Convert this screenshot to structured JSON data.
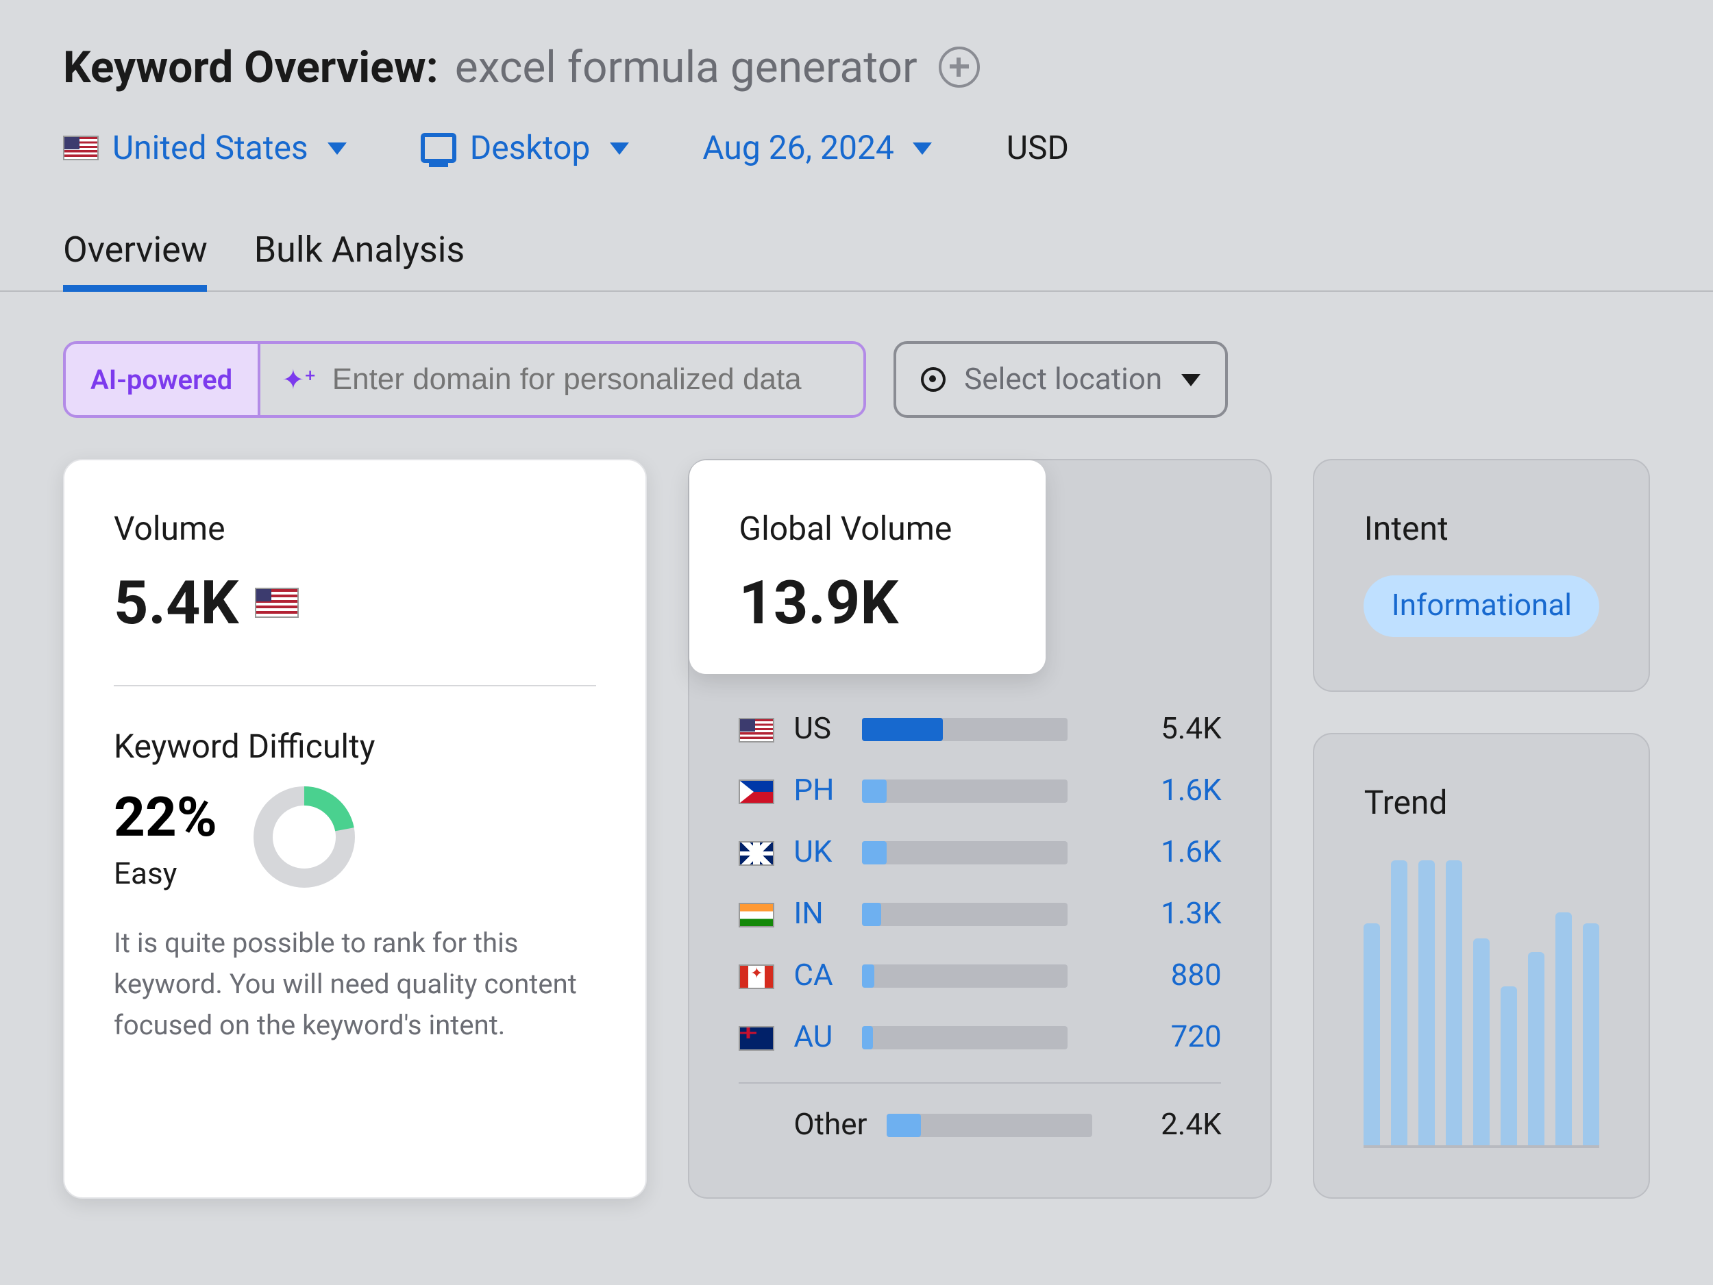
{
  "header": {
    "title_label": "Keyword Overview:",
    "keyword": "excel formula generator"
  },
  "filters": {
    "country": "United States",
    "device": "Desktop",
    "date": "Aug 26, 2024",
    "currency": "USD"
  },
  "tabs": {
    "overview": "Overview",
    "bulk": "Bulk Analysis",
    "active": "overview"
  },
  "ai": {
    "badge": "AI-powered",
    "placeholder": "Enter domain for personalized data",
    "location_placeholder": "Select location"
  },
  "volume": {
    "label": "Volume",
    "value": "5.4K",
    "country_code": "US"
  },
  "keyword_difficulty": {
    "label": "Keyword Difficulty",
    "percent_text": "22%",
    "percent": 22,
    "level": "Easy",
    "description": "It is quite possible to rank for this keyword. You will need quality content focused on the keyword's intent."
  },
  "global_volume": {
    "label": "Global Volume",
    "value": "13.9K",
    "rows": [
      {
        "code": "US",
        "flag": "us",
        "value": "5.4K",
        "pct": 39,
        "link": false,
        "dark": true
      },
      {
        "code": "PH",
        "flag": "ph",
        "value": "1.6K",
        "pct": 12,
        "link": true,
        "dark": false
      },
      {
        "code": "UK",
        "flag": "uk",
        "value": "1.6K",
        "pct": 12,
        "link": true,
        "dark": false
      },
      {
        "code": "IN",
        "flag": "in",
        "value": "1.3K",
        "pct": 9,
        "link": true,
        "dark": false
      },
      {
        "code": "CA",
        "flag": "ca",
        "value": "880",
        "pct": 6,
        "link": true,
        "dark": false
      },
      {
        "code": "AU",
        "flag": "au",
        "value": "720",
        "pct": 5,
        "link": true,
        "dark": false
      }
    ],
    "other_label": "Other",
    "other_value": "2.4K",
    "other_pct": 17
  },
  "intent": {
    "label": "Intent",
    "value": "Informational"
  },
  "trend": {
    "label": "Trend"
  },
  "chart_data": {
    "type": "bar",
    "title": "Trend",
    "ylim": [
      0,
      100
    ],
    "values": [
      78,
      100,
      100,
      100,
      73,
      56,
      68,
      82,
      78
    ]
  }
}
